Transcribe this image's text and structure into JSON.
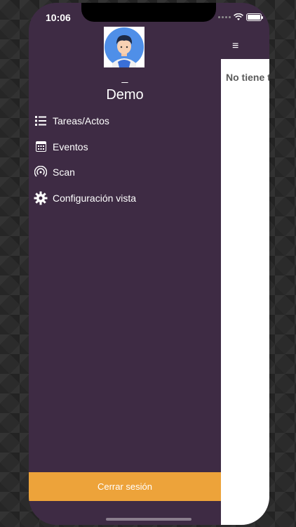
{
  "status_bar": {
    "time": "10:06"
  },
  "drawer": {
    "user_dash": "_",
    "username": "Demo",
    "items": [
      {
        "label": "Tareas/Actos",
        "icon": "list-icon"
      },
      {
        "label": "Eventos",
        "icon": "calendar-icon"
      },
      {
        "label": "Scan",
        "icon": "nfc-scan-icon"
      },
      {
        "label": "Configuración vista",
        "icon": "gear-icon"
      }
    ],
    "logout_label": "Cerrar sesión"
  },
  "main": {
    "menu_icon": "hamburger-icon",
    "message_partial": "No tiene t"
  },
  "colors": {
    "drawer_bg": "#3e2b44",
    "logout_bg": "#eda33a",
    "content_bg": "#ffffff"
  }
}
